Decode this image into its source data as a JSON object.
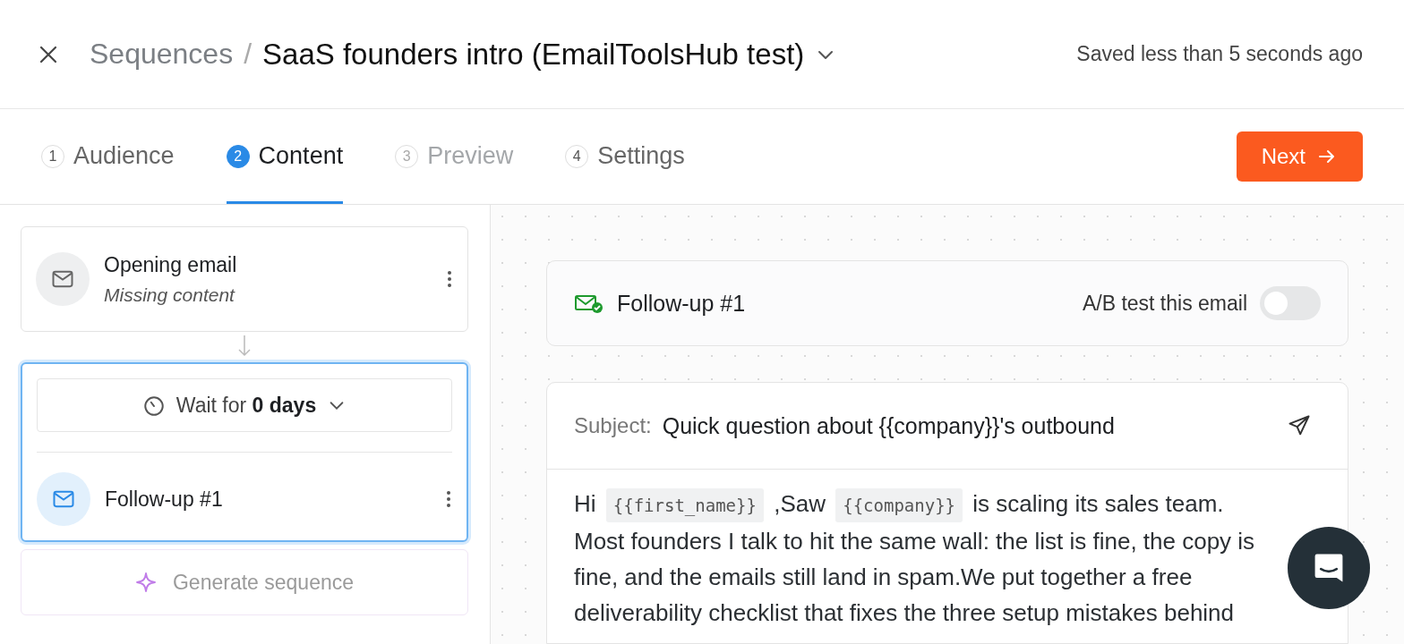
{
  "header": {
    "breadcrumb_parent": "Sequences",
    "separator": "/",
    "title": "SaaS founders intro (EmailToolsHub test)",
    "save_status": "Saved less than 5 seconds ago"
  },
  "tabs": [
    {
      "number": "1",
      "label": "Audience",
      "selected": false,
      "disabled": false
    },
    {
      "number": "2",
      "label": "Content",
      "selected": true,
      "disabled": false
    },
    {
      "number": "3",
      "label": "Preview",
      "selected": false,
      "disabled": true
    },
    {
      "number": "4",
      "label": "Settings",
      "selected": false,
      "disabled": false
    }
  ],
  "next_button": {
    "label": "Next"
  },
  "steps": [
    {
      "kind": "email",
      "title": "Opening email",
      "subtitle": "Missing content",
      "selected": false
    },
    {
      "kind": "email",
      "title": "Follow-up #1",
      "wait": "Wait for **0 days**",
      "selected": true
    }
  ],
  "generate_button": {
    "label": "Generate sequence"
  },
  "editor": {
    "email_title": "Follow-up #1",
    "ab_test": {
      "label": "A/B test this email",
      "on": false
    },
    "subject_label": "Subject:",
    "subject": "Quick question about {{company}}'s outbound",
    "body": [
      {
        "kind": "text",
        "text": "Hi "
      },
      {
        "kind": "token",
        "text": "{{first_name}}"
      },
      {
        "kind": "text",
        "text": " ,Saw "
      },
      {
        "kind": "token",
        "text": "{{company}}"
      },
      {
        "kind": "text",
        "text": " is scaling its sales team. Most founders I talk to hit the same wall: the list is fine, the copy is fine, and the emails still land in spam.We put together a free deliverability checklist that fixes the three setup mistakes behind"
      }
    ]
  }
}
